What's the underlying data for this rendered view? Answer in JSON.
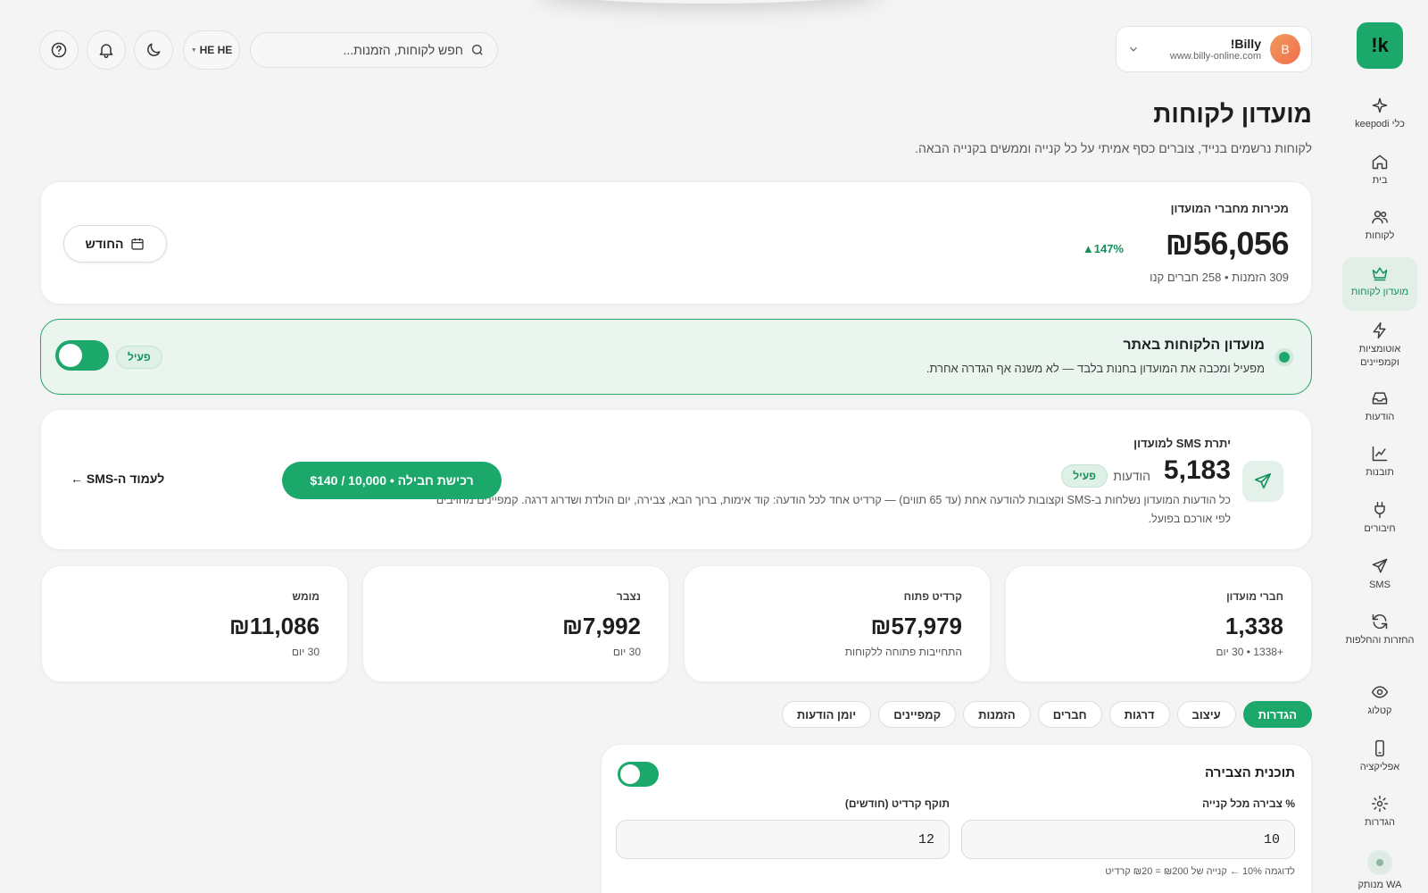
{
  "sidebar": {
    "logo": "!k",
    "items": [
      {
        "label": "כלי keepodi",
        "icon": "sparkle-icon"
      },
      {
        "label": "בית",
        "icon": "home-icon"
      },
      {
        "label": "לקוחות",
        "icon": "users-icon"
      },
      {
        "label": "מועדון לקוחות",
        "icon": "crown-icon",
        "active": true
      },
      {
        "label": "אוטומציות וקמפיינים",
        "icon": "bolt-icon"
      },
      {
        "label": "הודעות",
        "icon": "inbox-icon"
      },
      {
        "label": "תובנות",
        "icon": "chart-icon"
      },
      {
        "label": "חיבורים",
        "icon": "plug-icon"
      },
      {
        "label": "SMS",
        "icon": "send-icon"
      },
      {
        "label": "החזרות והחלפות",
        "icon": "refresh-icon"
      },
      {
        "label": "קטלוג",
        "icon": "eye-icon"
      },
      {
        "label": "אפליקציה",
        "icon": "phone-icon"
      },
      {
        "label": "הגדרות",
        "icon": "gear-icon"
      },
      {
        "label": "WA מנותק",
        "icon": "wa-status-icon"
      }
    ]
  },
  "header": {
    "store": {
      "avatar": "B",
      "name": "Billy!",
      "url": "www.billy-online.com"
    },
    "search": {
      "placeholder": "חפש לקוחות, הזמנות..."
    },
    "lang": "HE HE"
  },
  "page": {
    "title": "מועדון לקוחות",
    "subtitle": "לקוחות נרשמים בנייד, צוברים כסף אמיתי על כל קנייה וממשים בקנייה הבאה."
  },
  "sales": {
    "label": "מכירות מחברי המועדון",
    "value": "₪56,056",
    "growth": "▲147%",
    "meta": "309 הזמנות • 258 חברים קנו",
    "period_button": "החודש"
  },
  "site_club": {
    "title": "מועדון הלקוחות באתר",
    "description": "מפעיל ומכבה את המועדון בחנות בלבד — לא משנה אף הגדרה אחרת.",
    "status": "פעיל"
  },
  "sms": {
    "label": "יתרת SMS למועדון",
    "count": "5,183",
    "unit": "הודעות",
    "status": "פעיל",
    "description": "כל הודעות המועדון נשלחות ב-SMS וקצובות להודעה אחת (עד 65 תווים) — קרדיט אחד לכל הודעה: קוד אימות, ברוך הבא, צבירה, יום הולדת ושדרוג דרגה. קמפיינים מחויבים לפי אורכם בפועל.",
    "buy_button": "רכישת חבילה • 10,000 / $140",
    "link": "לעמוד ה-SMS ←"
  },
  "stats": [
    {
      "label": "חברי מועדון",
      "value": "1,338",
      "sub": "+1338 • 30 יום"
    },
    {
      "label": "קרדיט פתוח",
      "value": "₪57,979",
      "sub": "התחייבות פתוחה ללקוחות"
    },
    {
      "label": "נצבר",
      "value": "₪7,992",
      "sub": "30 יום"
    },
    {
      "label": "מומש",
      "value": "₪11,086",
      "sub": "30 יום"
    }
  ],
  "tabs": [
    {
      "label": "הגדרות",
      "active": true
    },
    {
      "label": "עיצוב"
    },
    {
      "label": "דרגות"
    },
    {
      "label": "חברים"
    },
    {
      "label": "הזמנות"
    },
    {
      "label": "קמפיינים"
    },
    {
      "label": "יומן הודעות"
    }
  ],
  "accrual": {
    "title": "תוכנית הצבירה",
    "percent_label": "% צבירה מכל קנייה",
    "percent_value": "10",
    "expiry_label": "תוקף קרדיט (חודשים)",
    "expiry_value": "12",
    "hint": "לדוגמה 10% ← קנייה של ₪200 = ₪20 קרדיט"
  },
  "colors": {
    "accent": "#1ba86a",
    "accent_dark": "#13915b",
    "background": "#f3f4f3"
  }
}
